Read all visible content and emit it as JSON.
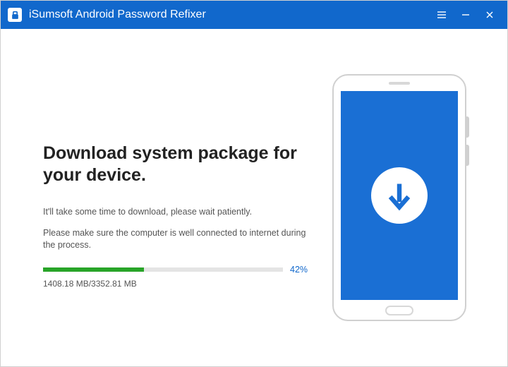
{
  "app": {
    "title": "iSumsoft Android Password Refixer"
  },
  "colors": {
    "brand": "#1168cc",
    "progress": "#28a428"
  },
  "download": {
    "heading": "Download system package for your device.",
    "wait_text": "It'll take some time to download, please wait patiently.",
    "connection_text": "Please make sure the computer is well connected to internet during the process.",
    "percent": 42,
    "percent_label": "42%",
    "downloaded_mb": 1408.18,
    "total_mb": 3352.81,
    "size_label": "1408.18 MB/3352.81 MB"
  }
}
